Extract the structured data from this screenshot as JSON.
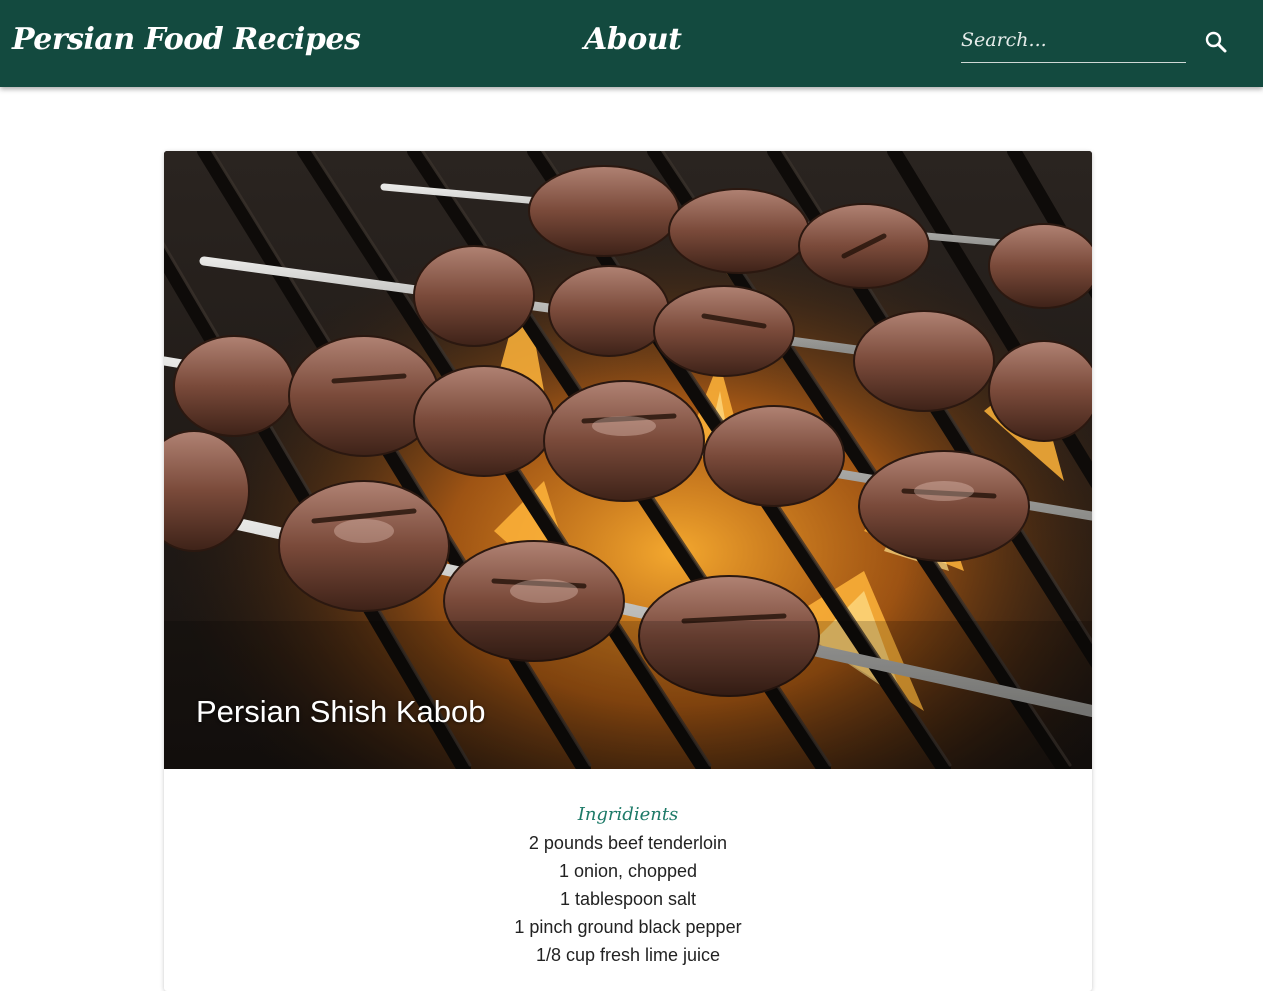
{
  "navbar": {
    "brand": "Persian Food Recipes",
    "about_link": "About",
    "search": {
      "placeholder": "Search...",
      "value": "",
      "icon": "search-icon"
    },
    "background_color": "#134a3f"
  },
  "recipe_card": {
    "title": "Persian Shish Kabob",
    "image": "grilled-beef-kabob-skewers-over-flames",
    "ingredients_heading": "Ingridients",
    "ingredients": [
      "2 pounds beef tenderloin",
      "1 onion, chopped",
      "1 tablespoon salt",
      "1 pinch ground black pepper",
      "1/8 cup fresh lime juice"
    ]
  },
  "colors": {
    "accent_heading": "#1d7a68",
    "body_text": "#222222"
  }
}
